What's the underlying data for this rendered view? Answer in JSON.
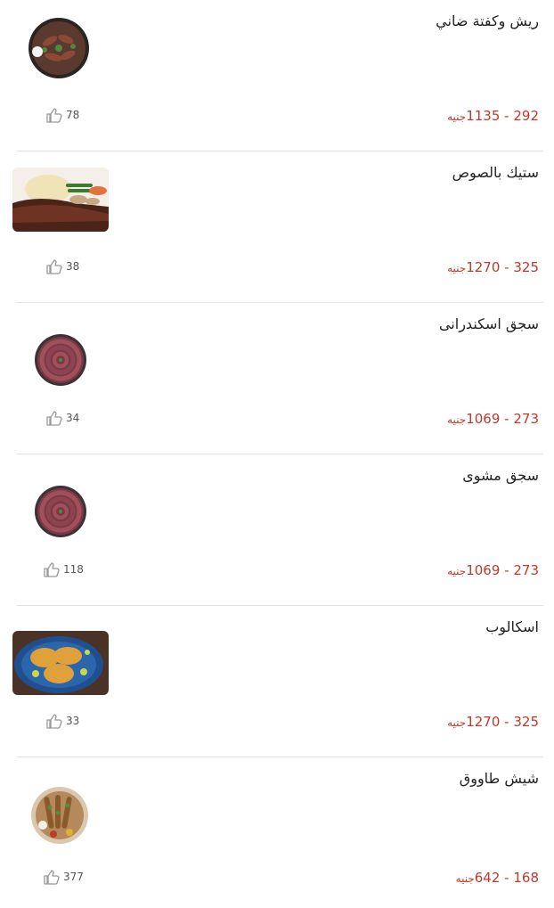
{
  "currency": "جنيه",
  "items": [
    {
      "name": "ريش وكفتة ضاني",
      "price_range": "292 - 1135",
      "likes": "78",
      "image": "grill-platter-icon"
    },
    {
      "name": "ستيك بالصوص",
      "price_range": "325 - 1270",
      "likes": "38",
      "image": "steak-plate-icon"
    },
    {
      "name": "سجق اسكندرانى",
      "price_range": "273 - 1069",
      "likes": "34",
      "image": "sausage-coil-icon"
    },
    {
      "name": "سجق مشوى",
      "price_range": "273 - 1069",
      "likes": "118",
      "image": "sausage-coil-icon"
    },
    {
      "name": "اسكالوب",
      "price_range": "325 - 1270",
      "likes": "33",
      "image": "escalope-plate-icon"
    },
    {
      "name": "شيش طاووق",
      "price_range": "168 - 642",
      "likes": "377",
      "image": "shish-tawook-icon"
    }
  ]
}
